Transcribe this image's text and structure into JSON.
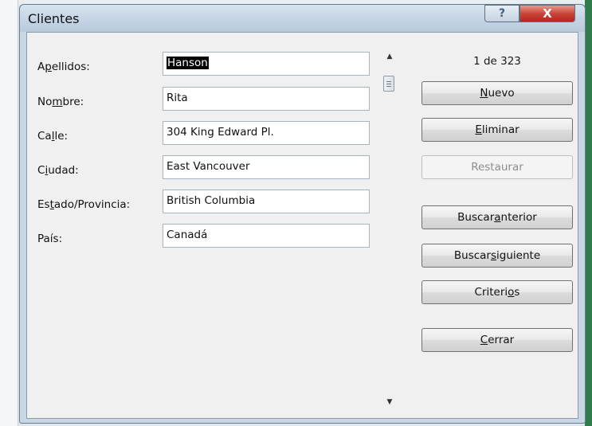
{
  "window": {
    "title": "Clientes"
  },
  "titlebar": {
    "help_label": "?",
    "close_label": "X"
  },
  "fields": [
    {
      "label_pre": "A",
      "label_ul": "p",
      "label_post": "ellidos:",
      "value": "Hanson"
    },
    {
      "label_pre": "No",
      "label_ul": "m",
      "label_post": "bre:",
      "value": "Rita"
    },
    {
      "label_pre": "Ca",
      "label_ul": "l",
      "label_post": "le:",
      "value": "304 King Edward Pl."
    },
    {
      "label_pre": "C",
      "label_ul": "i",
      "label_post": "udad:",
      "value": "East Vancouver"
    },
    {
      "label_pre": "Es",
      "label_ul": "t",
      "label_post": "ado/Provincia:",
      "value": "British Columbia"
    },
    {
      "label_pre": "",
      "label_ul": "",
      "label_post": "País:",
      "value": "Canadá"
    }
  ],
  "record": {
    "counter": "1 de 323"
  },
  "buttons": {
    "new": {
      "pre": "",
      "ul": "N",
      "post": "uevo"
    },
    "delete": {
      "pre": "",
      "ul": "E",
      "post": "liminar"
    },
    "restore": {
      "label": "Restaurar"
    },
    "find_prev": {
      "pre": "Buscar ",
      "ul": "a",
      "post": "nterior"
    },
    "find_next": {
      "pre": "Buscar ",
      "ul": "s",
      "post": "iguiente"
    },
    "criteria": {
      "pre": "Criteri",
      "ul": "o",
      "post": "s"
    },
    "close": {
      "pre": "",
      "ul": "C",
      "post": "errar"
    }
  }
}
